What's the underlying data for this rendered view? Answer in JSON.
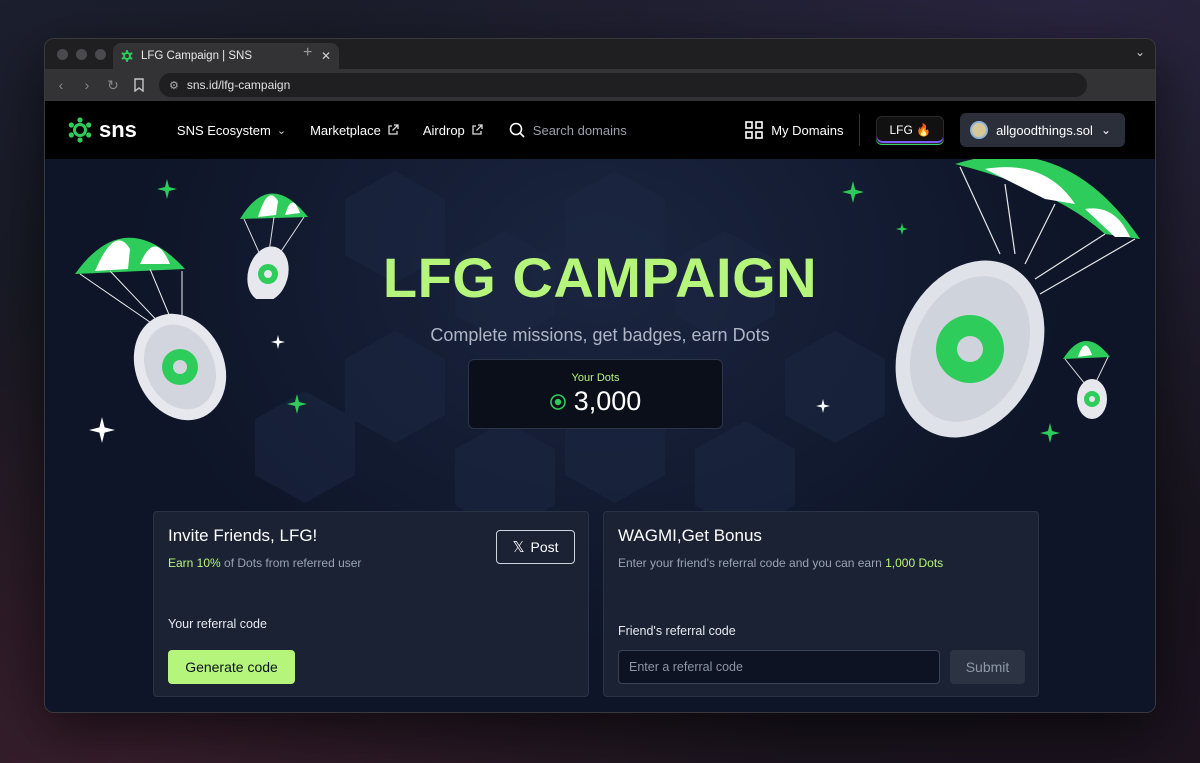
{
  "browser": {
    "tab_title": "LFG Campaign | SNS",
    "url": "sns.id/lfg-campaign"
  },
  "header": {
    "logo_text": "sns",
    "nav": [
      {
        "label": "SNS Ecosystem",
        "icon": "chevron-down-icon"
      },
      {
        "label": "Marketplace",
        "icon": "external-link-icon"
      },
      {
        "label": "Airdrop",
        "icon": "external-link-icon"
      }
    ],
    "search_placeholder": "Search domains",
    "my_domains": "My Domains",
    "lfg_button": "LFG 🔥",
    "wallet": "allgoodthings.sol"
  },
  "hero": {
    "title": "LFG CAMPAIGN",
    "subtitle": "Complete missions, get badges, earn Dots",
    "dots_label": "Your Dots",
    "dots_value": "3,000"
  },
  "invite_card": {
    "title": "Invite Friends, LFG!",
    "earn_highlight": "Earn 10%",
    "earn_rest": "of Dots from referred user",
    "post_button": "Post",
    "referral_label": "Your referral code",
    "generate_button": "Generate code"
  },
  "bonus_card": {
    "title": "WAGMI,Get Bonus",
    "desc": "Enter your friend's referral code and you can earn",
    "desc_highlight": "1,000 Dots",
    "friend_label": "Friend's referral code",
    "input_placeholder": "Enter a referral code",
    "submit_button": "Submit"
  },
  "colors": {
    "accent": "#b6f57b",
    "brand_green": "#2ecc5a",
    "page_bg": "#0e1528",
    "card_bg": "#1a2233"
  }
}
